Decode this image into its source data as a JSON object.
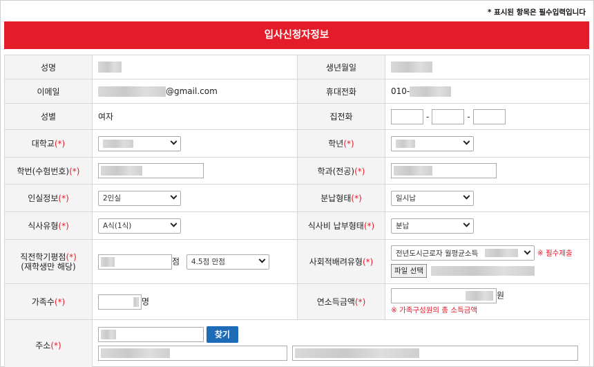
{
  "notice": "* 표시된 항목은 필수입력입니다",
  "banner_title": "입사신청자정보",
  "colors": {
    "accent": "#e41c2a",
    "button": "#1e6bb8"
  },
  "fields": {
    "name_label": "성명",
    "birth_label": "생년월일",
    "email_label": "이메일",
    "email_domain": "@gmail.com",
    "mobile_label": "휴대전화",
    "mobile_prefix": "010-",
    "gender_label": "성별",
    "gender_value": "여자",
    "home_phone_label": "집전화",
    "phone_dash": "-",
    "university_label": "대학교",
    "grade_label": "학년",
    "student_id_label": "학번(수험번호)",
    "major_label": "학과(전공)",
    "room_label": "인실정보",
    "room_value": "2인실",
    "payment_label": "분납형태",
    "payment_value": "일시납",
    "meal_label": "식사유형",
    "meal_value": "A식(1식)",
    "meal_payment_label": "식사비 납부형태",
    "meal_payment_value": "분납",
    "gpa_label": "직전학기평점",
    "gpa_sub_label": "(재학생만 해당)",
    "gpa_unit": "점",
    "gpa_scale_value": "4.5점 만점",
    "social_label": "사회적배려유형",
    "social_value": "전년도시근로자 월평균소득",
    "social_note": "※ 필수제출",
    "file_button": "파일 선택",
    "family_label": "가족수",
    "family_unit": "명",
    "income_label": "연소득금액",
    "income_unit": "원",
    "income_note": "※ 가족구성원의 총 소득금액",
    "address_label": "주소",
    "search_button": "찾기",
    "required_mark": "(*)"
  }
}
